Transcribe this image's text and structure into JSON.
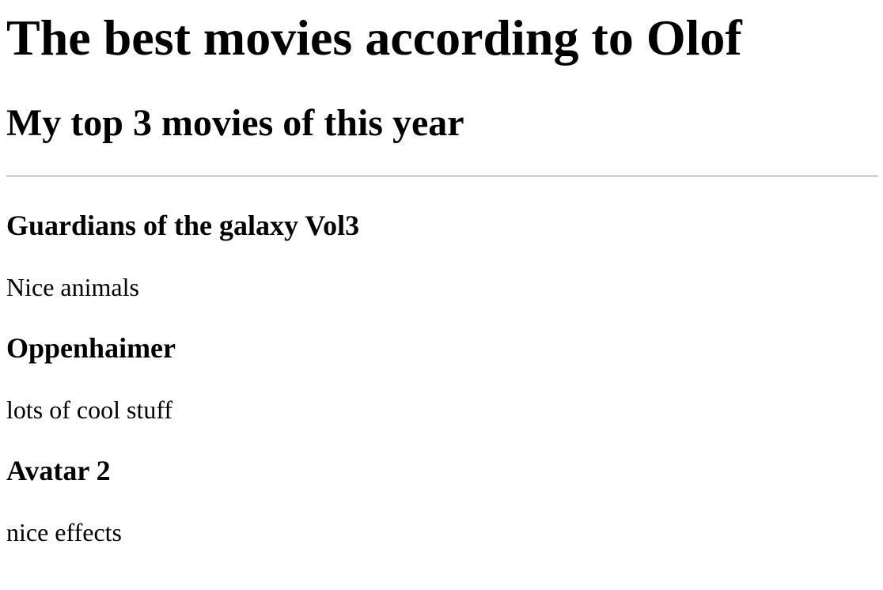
{
  "page": {
    "title": "The best movies according to Olof",
    "subtitle": "My top 3 movies of this year"
  },
  "movies": [
    {
      "title": "Guardians of the galaxy Vol3",
      "description": "Nice animals"
    },
    {
      "title": "Oppenhaimer",
      "description": "lots of cool stuff"
    },
    {
      "title": "Avatar 2",
      "description": "nice effects"
    }
  ]
}
